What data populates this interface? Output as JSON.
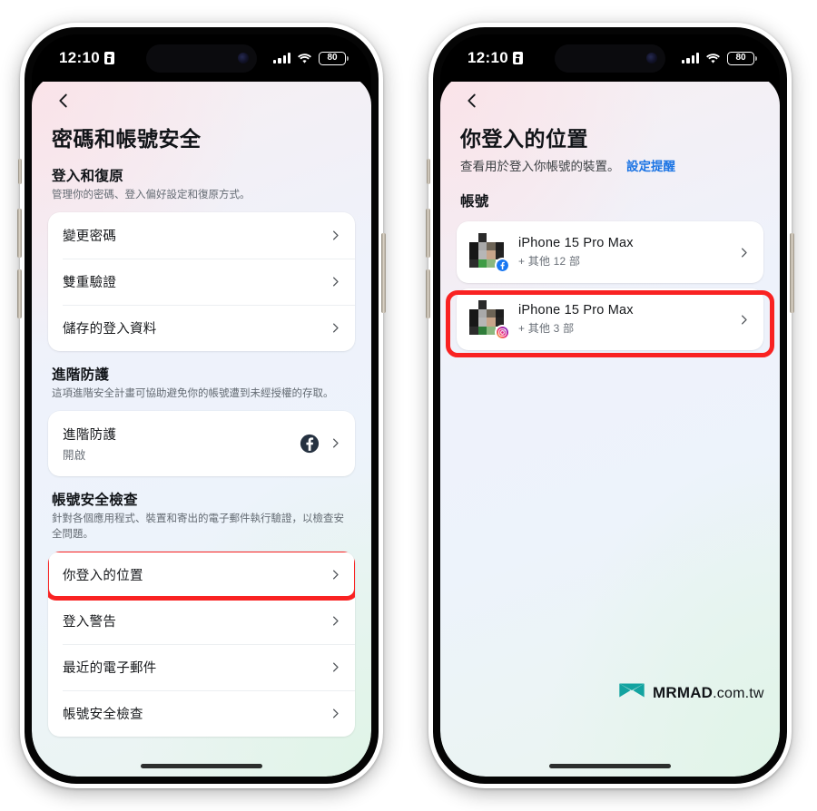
{
  "statusbar": {
    "time": "12:10",
    "battery_level": "80",
    "icons": [
      "lock-icon",
      "cellular-signal-icon",
      "wifi-icon",
      "battery-icon"
    ]
  },
  "colors": {
    "highlight_red": "#f92222",
    "link_blue": "#1b74e4",
    "facebook_navy": "#253140",
    "logo_teal": "#13a3a0"
  },
  "left_phone": {
    "back_label": "返回",
    "title": "密碼和帳號安全",
    "sections": [
      {
        "heading": "登入和復原",
        "description": "管理你的密碼、登入偏好設定和復原方式。",
        "rows": [
          {
            "label": "變更密碼"
          },
          {
            "label": "雙重驗證"
          },
          {
            "label": "儲存的登入資料"
          }
        ]
      },
      {
        "heading": "進階防護",
        "description": "這項進階安全計畫可協助避免你的帳號遭到未經授權的存取。",
        "rows": [
          {
            "label": "進階防護",
            "sub": "開啟",
            "badge": "facebook-icon"
          }
        ]
      },
      {
        "heading": "帳號安全檢查",
        "description": "針對各個應用程式、裝置和寄出的電子郵件執行驗證，以檢查安全問題。",
        "rows": [
          {
            "label": "你登入的位置",
            "highlighted": true
          },
          {
            "label": "登入警告"
          },
          {
            "label": "最近的電子郵件"
          },
          {
            "label": "帳號安全檢查"
          }
        ]
      }
    ]
  },
  "right_phone": {
    "back_label": "返回",
    "title": "你登入的位置",
    "subtitle_text": "查看用於登入你帳號的裝置。",
    "subtitle_link": "設定提醒",
    "section_heading": "帳號",
    "devices": [
      {
        "name": "iPhone 15 Pro Max",
        "sub": "+ 其他 12 部",
        "badge": "facebook-icon",
        "highlighted": false
      },
      {
        "name": "iPhone 15 Pro Max",
        "sub": "+ 其他 3 部",
        "badge": "instagram-icon",
        "highlighted": true
      }
    ],
    "watermark": {
      "brand": "MRMAD",
      "suffix": ".com.tw",
      "logo": "mrmad-logo-icon"
    }
  }
}
